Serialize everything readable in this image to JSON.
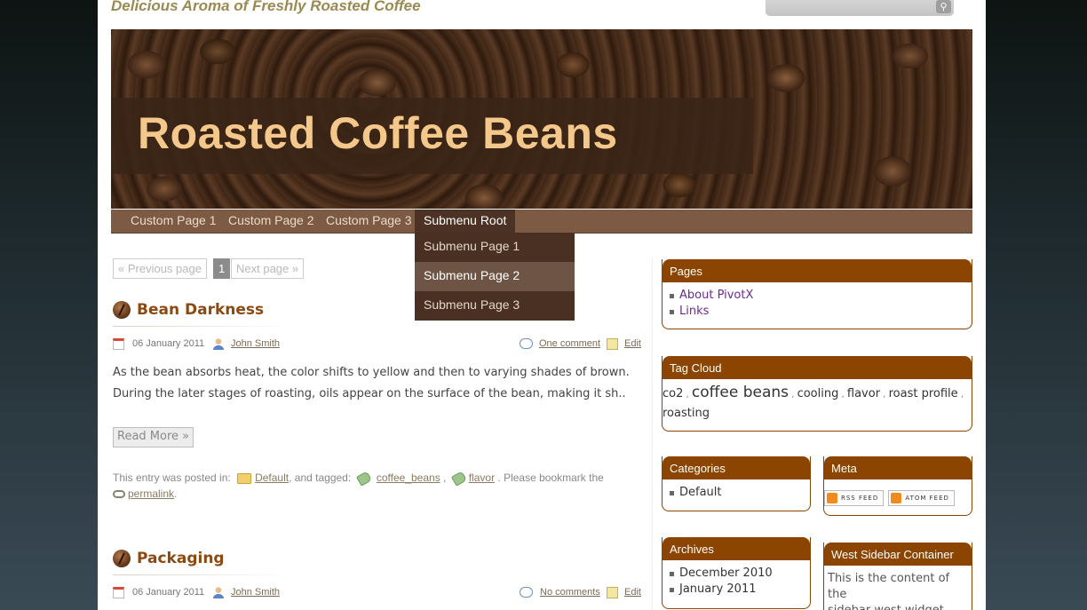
{
  "site": {
    "tagline": "Delicious Aroma of Freshly Roasted Coffee",
    "title": "Roasted Coffee Beans"
  },
  "nav": {
    "items": [
      "Custom Page 1",
      "Custom Page 2",
      "Custom Page 3",
      "Submenu Root"
    ],
    "active": "Submenu Root",
    "submenu": [
      "Submenu Page 1",
      "Submenu Page 2",
      "Submenu Page 3"
    ],
    "submenu_hovered": "Submenu Page 2"
  },
  "pagination": {
    "previous": "« Previous page",
    "current": "1",
    "next": "Next page »"
  },
  "posts": [
    {
      "title": "Bean Darkness",
      "date": "06 January 2011",
      "author": "John Smith",
      "comments": "One comment",
      "edit": "Edit",
      "excerpt_line1": "As the bean absorbs heat, the color shifts to yellow and then to varying shades of brown.",
      "excerpt_line2": "During the later stages of roasting, oils appear on the surface of the bean, making it sh..",
      "read_more": "Read More »",
      "posted_in_prefix": "This entry was posted in:",
      "category": "Default",
      "tagged_text": ", and tagged:",
      "tags": [
        "coffee_beans",
        "flavor"
      ],
      "bookmark_text": ". Please bookmark the",
      "permalink": "permalink",
      "period": "."
    },
    {
      "title": "Packaging",
      "date": "06 January 2011",
      "author": "John Smith",
      "comments": "No comments",
      "edit": "Edit"
    }
  ],
  "sidebar": {
    "pages": {
      "title": "Pages",
      "items": [
        "About PivotX",
        "Links"
      ]
    },
    "tag_cloud": {
      "title": "Tag Cloud",
      "tags": [
        "co2",
        "coffee beans",
        "cooling",
        "flavor",
        "roast profile",
        "roasting"
      ]
    },
    "categories": {
      "title": "Categories",
      "items": [
        "Default"
      ]
    },
    "meta": {
      "title": "Meta",
      "rss": "RSS FEED",
      "atom": "ATOM FEED"
    },
    "archives": {
      "title": "Archives",
      "items": [
        "December 2010",
        "January 2011"
      ]
    },
    "west": {
      "title": "West Sidebar Container",
      "text_line1": "This is the content of the",
      "text_line2": "sidebar west widget"
    }
  },
  "colors": {
    "accent": "#8b4500",
    "title_text": "#f3c88a",
    "nav_bg": "#7d5a43",
    "submenu_bg": "#4a3022",
    "post_title": "#8b4a12"
  }
}
